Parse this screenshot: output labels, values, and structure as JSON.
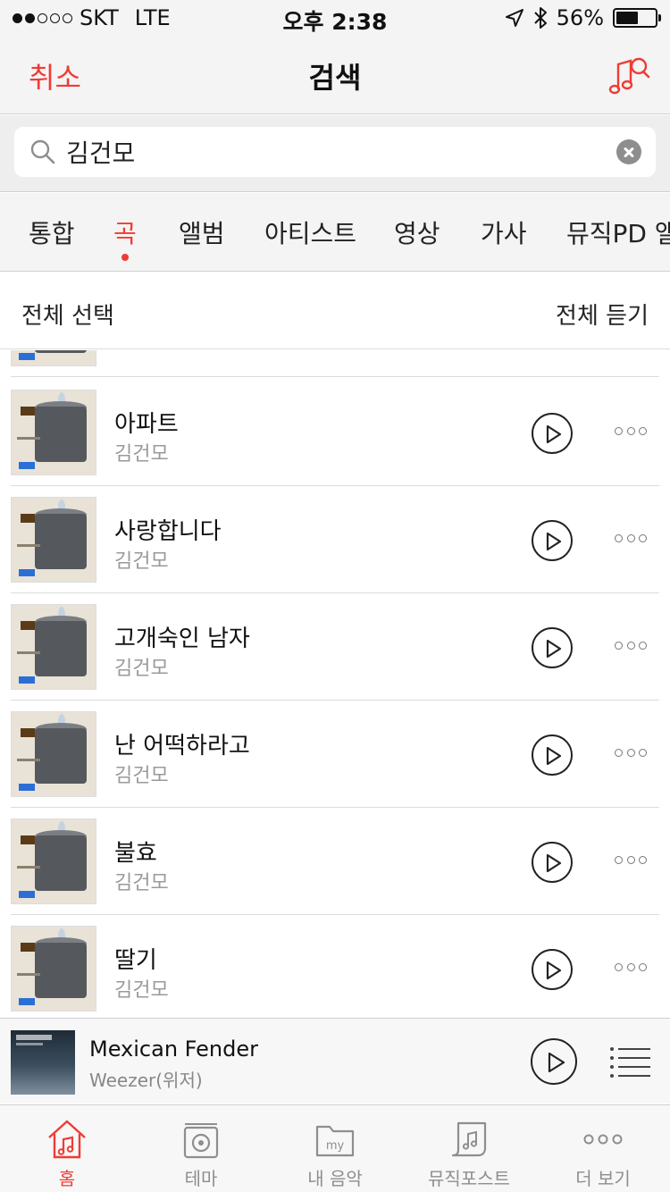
{
  "status_bar": {
    "carrier": "SKT",
    "network": "LTE",
    "time": "오후 2:38",
    "battery": "56%",
    "signal_bars": 2,
    "battery_level": 0.56
  },
  "nav": {
    "cancel_label": "취소",
    "title": "검색",
    "music_search_icon": "music-search-icon"
  },
  "search": {
    "value": "김건모",
    "placeholder": ""
  },
  "tabs": [
    {
      "label": "통합",
      "active": false
    },
    {
      "label": "곡",
      "active": true
    },
    {
      "label": "앨범",
      "active": false
    },
    {
      "label": "아티스트",
      "active": false
    },
    {
      "label": "영상",
      "active": false
    },
    {
      "label": "가사",
      "active": false
    },
    {
      "label": "뮤직PD 앨범",
      "active": false
    }
  ],
  "list_header": {
    "select_all": "전체 선택",
    "play_all": "전체 듣기"
  },
  "songs": [
    {
      "title": "아파트",
      "artist": "김건모"
    },
    {
      "title": "사랑합니다",
      "artist": "김건모"
    },
    {
      "title": "고개숙인 남자",
      "artist": "김건모"
    },
    {
      "title": "난 어떡하라고",
      "artist": "김건모"
    },
    {
      "title": "불효",
      "artist": "김건모"
    },
    {
      "title": "딸기",
      "artist": "김건모"
    }
  ],
  "mini_player": {
    "title": "Mexican Fender",
    "artist": "Weezer(위저)"
  },
  "tab_bar": [
    {
      "label": "홈",
      "icon": "home-music-icon",
      "active": true
    },
    {
      "label": "테마",
      "icon": "radio-icon",
      "active": false
    },
    {
      "label": "내 음악",
      "icon": "my-folder-icon",
      "active": false
    },
    {
      "label": "뮤직포스트",
      "icon": "music-post-icon",
      "active": false
    },
    {
      "label": "더 보기",
      "icon": "more-icon",
      "active": false
    }
  ],
  "colors": {
    "accent": "#f03b35",
    "bar_bg": "#f4f4f4",
    "secondary_text": "#9a9a9a"
  }
}
